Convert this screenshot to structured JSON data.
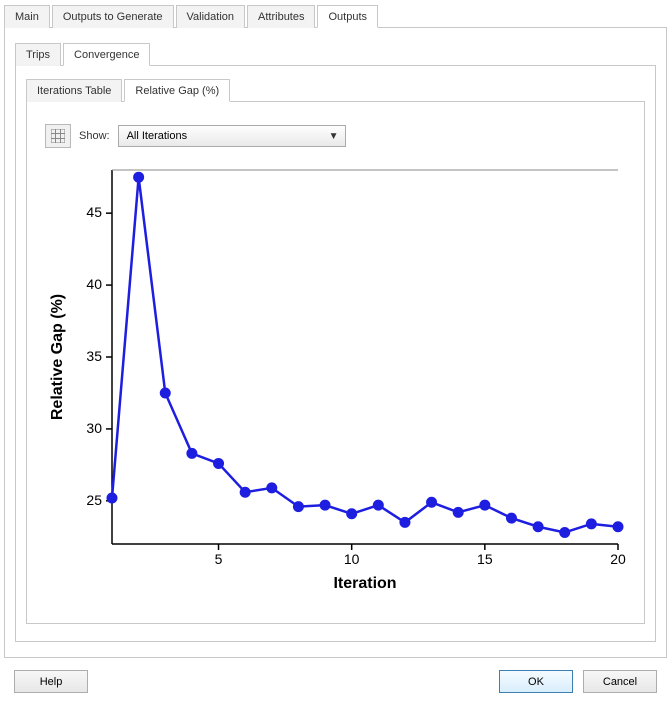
{
  "tabs_main": {
    "items": [
      "Main",
      "Outputs to Generate",
      "Validation",
      "Attributes",
      "Outputs"
    ],
    "active": 4
  },
  "tabs_sub": {
    "items": [
      "Trips",
      "Convergence"
    ],
    "active": 1
  },
  "tabs_inner": {
    "items": [
      "Iterations Table",
      "Relative Gap (%)"
    ],
    "active": 1
  },
  "toolbar": {
    "show_label": "Show:",
    "dropdown_value": "All Iterations"
  },
  "buttons": {
    "help": "Help",
    "ok": "OK",
    "cancel": "Cancel"
  },
  "chart_data": {
    "type": "line",
    "title": "",
    "xlabel": "Iteration",
    "ylabel": "Relative Gap (%)",
    "xlim": [
      1,
      20
    ],
    "ylim": [
      22,
      48
    ],
    "xticks": [
      5,
      10,
      15,
      20
    ],
    "yticks": [
      25,
      30,
      35,
      40,
      45
    ],
    "x": [
      1,
      2,
      3,
      4,
      5,
      6,
      7,
      8,
      9,
      10,
      11,
      12,
      13,
      14,
      15,
      16,
      17,
      18,
      19,
      20
    ],
    "values": [
      25.2,
      47.5,
      32.5,
      28.3,
      27.6,
      25.6,
      25.9,
      24.6,
      24.7,
      24.1,
      24.7,
      23.5,
      24.9,
      24.2,
      24.7,
      23.8,
      23.2,
      22.8,
      23.4,
      23.2
    ],
    "line_color": "#1e1ee0",
    "marker_fill": "#1e1ee0"
  }
}
